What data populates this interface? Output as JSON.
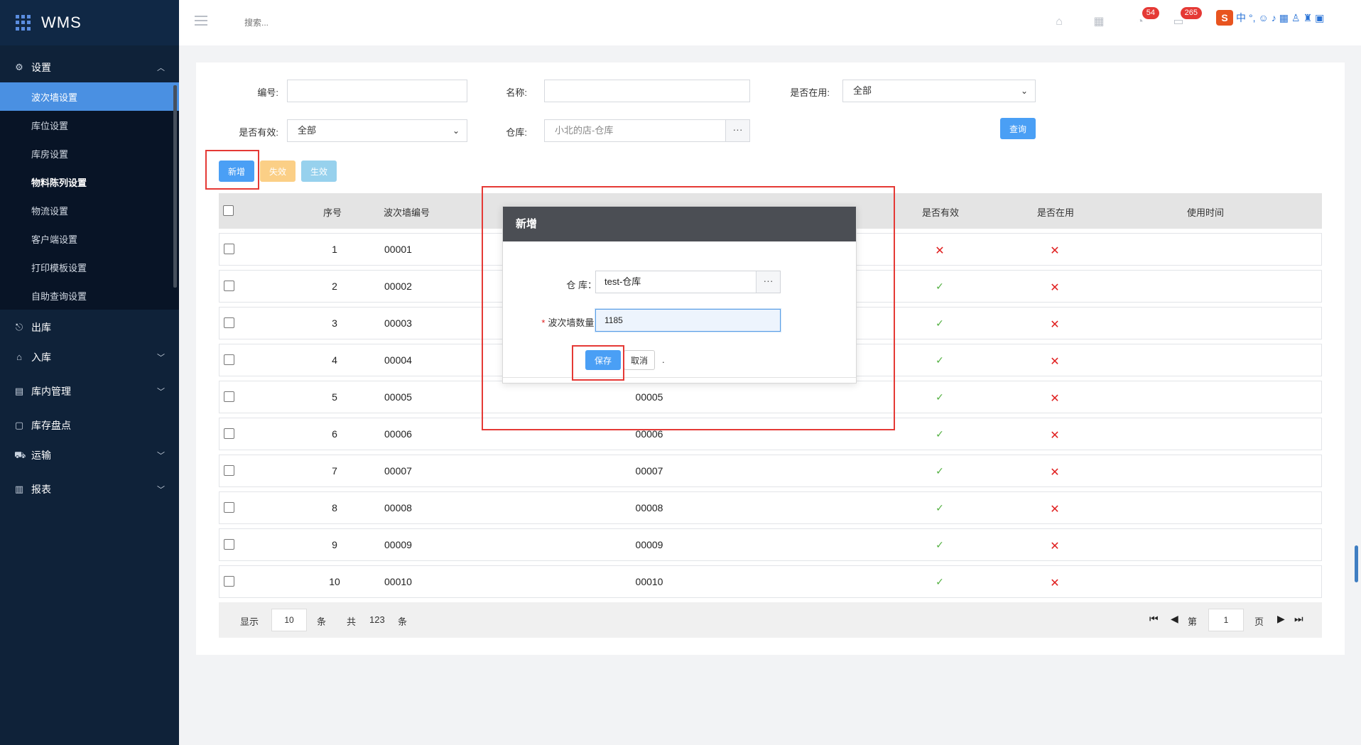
{
  "app": {
    "title": "WMS"
  },
  "sidebar": {
    "groups": [
      {
        "label": "设置",
        "icon": "gear-icon",
        "expanded": true
      },
      {
        "label": "出库",
        "icon": "outbound-icon"
      },
      {
        "label": "入库",
        "icon": "inbound-icon"
      },
      {
        "label": "库内管理",
        "icon": "warehouse-icon"
      },
      {
        "label": "库存盘点",
        "icon": "inventory-icon"
      },
      {
        "label": "运输",
        "icon": "truck-icon"
      },
      {
        "label": "报表",
        "icon": "chart-icon"
      }
    ],
    "settings_items": [
      "波次墙设置",
      "库位设置",
      "库房设置",
      "物料陈列设置",
      "物流设置",
      "客户端设置",
      "打印模板设置",
      "自助查询设置"
    ],
    "active_item": "波次墙设置"
  },
  "topbar": {
    "search_placeholder": "搜索...",
    "notif_count": "54",
    "msg_count": "265",
    "ime_text": "中"
  },
  "filters": {
    "code_label": "编号:",
    "name_label": "名称:",
    "in_use_label": "是否在用:",
    "in_use_value": "全部",
    "valid_label": "是否有效:",
    "valid_value": "全部",
    "warehouse_label": "仓库:",
    "warehouse_value": "小北的店-仓库",
    "query_button": "查询"
  },
  "toolbar": {
    "add": "新增",
    "disable": "失效",
    "enable": "生效"
  },
  "table": {
    "headers": {
      "seq": "序号",
      "code": "波次墙编号",
      "valid": "是否有效",
      "in_use": "是否在用",
      "used_time": "使用时间"
    },
    "rows": [
      {
        "seq": "1",
        "code": "00001",
        "name": "",
        "valid": "no",
        "in_use": "no"
      },
      {
        "seq": "2",
        "code": "00002",
        "name": "",
        "valid": "yes",
        "in_use": "no"
      },
      {
        "seq": "3",
        "code": "00003",
        "name": "",
        "valid": "yes",
        "in_use": "no"
      },
      {
        "seq": "4",
        "code": "00004",
        "name": "",
        "valid": "yes",
        "in_use": "no"
      },
      {
        "seq": "5",
        "code": "00005",
        "name": "00005",
        "valid": "yes",
        "in_use": "no"
      },
      {
        "seq": "6",
        "code": "00006",
        "name": "00006",
        "valid": "yes",
        "in_use": "no"
      },
      {
        "seq": "7",
        "code": "00007",
        "name": "00007",
        "valid": "yes",
        "in_use": "no"
      },
      {
        "seq": "8",
        "code": "00008",
        "name": "00008",
        "valid": "yes",
        "in_use": "no"
      },
      {
        "seq": "9",
        "code": "00009",
        "name": "00009",
        "valid": "yes",
        "in_use": "no"
      },
      {
        "seq": "10",
        "code": "00010",
        "name": "00010",
        "valid": "yes",
        "in_use": "no"
      }
    ]
  },
  "pagination": {
    "show_label": "显示",
    "page_size": "10",
    "unit": "条",
    "total_label": "共",
    "total": "123",
    "total_unit": "条",
    "page_prefix": "第",
    "page": "1",
    "page_suffix": "页"
  },
  "modal": {
    "title": "新增",
    "warehouse_label": "仓 库：",
    "warehouse_value": "test-仓库",
    "qty_label": "波次墙数量:",
    "qty_value": "1185",
    "save": "保存",
    "cancel": "取消",
    "dot": "."
  }
}
